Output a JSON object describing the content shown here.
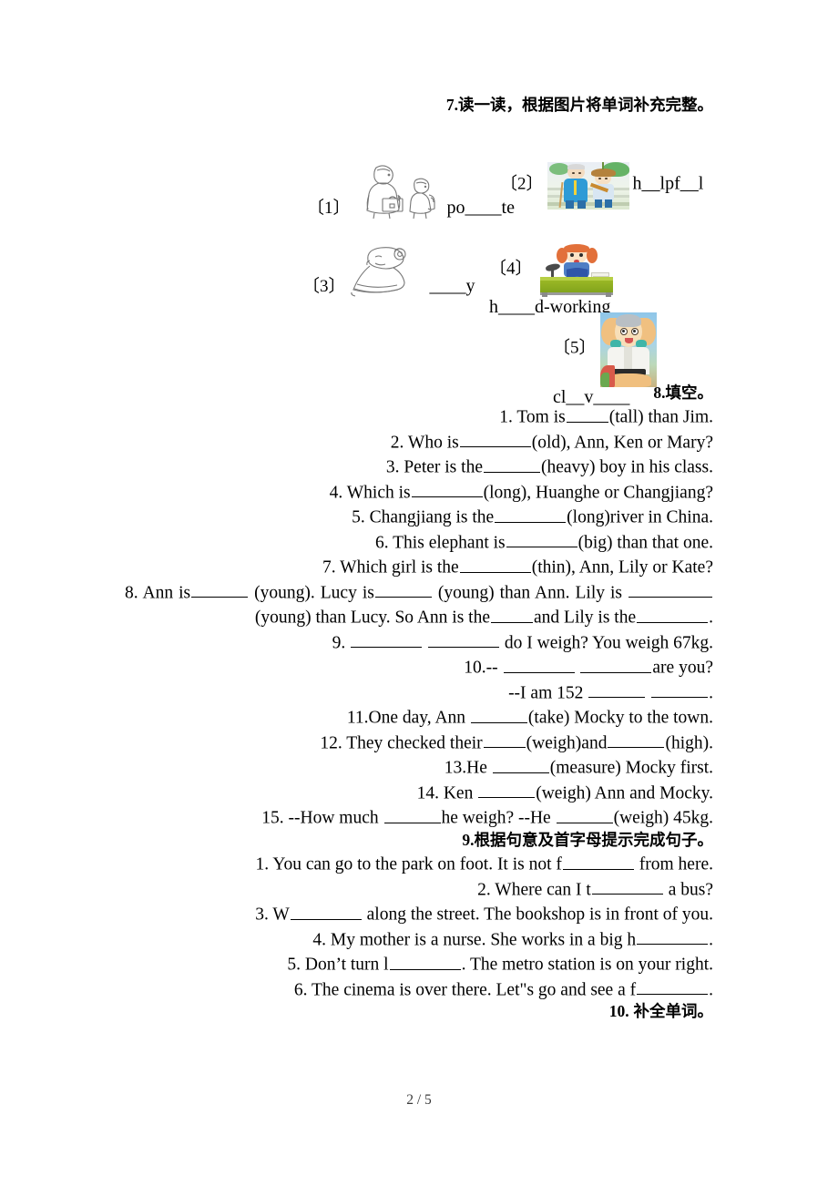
{
  "document": {
    "footer_page": "2 / 5"
  },
  "sections": [
    {
      "id": "section-7",
      "number": "7.",
      "heading": "读一读，根据图片将单词补充完整。",
      "type": "picture-word",
      "items": [
        {
          "label": "〔1〕",
          "word": "po____te",
          "image": "line-drawing-adult-with-briefcase-and-child-with-backpack"
        },
        {
          "label": "〔2〕",
          "word": "h__lpf__l",
          "image": "photo-boy-helping-elderly-man-with-cane"
        },
        {
          "label": "〔3〕",
          "word": "____y",
          "image": "line-drawing-person-face-with-flower"
        },
        {
          "label": "〔4〕",
          "word": "h____d-working",
          "image": "photo-girl-studying-at-green-desk-with-lamp"
        },
        {
          "label": "〔5〕",
          "word": "cl__v____",
          "image": "photo-cartoon-character-hands-behind-head"
        }
      ]
    },
    {
      "id": "section-8",
      "number": "8.",
      "heading": "填空。",
      "questions": [
        {
          "n": "1.",
          "parts": [
            "Tom is",
            "blank-sm",
            "(tall) than Jim."
          ]
        },
        {
          "n": "2.",
          "parts": [
            "Who is",
            "blank-lg",
            "(old), Ann, Ken or Mary?"
          ]
        },
        {
          "n": "3.",
          "parts": [
            "Peter is the",
            "blank-md",
            "(heavy) boy in his class."
          ]
        },
        {
          "n": "4.",
          "parts": [
            "Which is",
            "blank-lg",
            "(long), Huanghe or Changjiang?"
          ]
        },
        {
          "n": "5.",
          "parts": [
            "Changjiang is the",
            "blank-lg",
            "(long)river in China."
          ]
        },
        {
          "n": "6.",
          "parts": [
            "This elephant is",
            "blank-lg",
            "(big) than that one."
          ]
        },
        {
          "n": "7.",
          "parts": [
            "Which girl is the",
            "blank-lg",
            "(thin), Ann, Lily or Kate?"
          ]
        },
        {
          "n": "8.",
          "text_1": "Ann is",
          "text_2": "(young). Lucy is",
          "text_3": "(young) than Ann. Lily is",
          "text_4": "(young) than Lucy. So Ann is the",
          "text_5": "and Lily is the",
          "text_6": "."
        },
        {
          "n": "9.",
          "parts": [
            "",
            "blank-lg",
            "blank-lg",
            "do I weigh? You weigh 67kg."
          ]
        },
        {
          "n": "10.--",
          "parts": [
            "",
            "blank-lg",
            "blank-lg",
            "are you?"
          ]
        },
        {
          "n": "",
          "parts": [
            "--I am 152",
            "blank-md",
            "blank-md",
            "."
          ]
        },
        {
          "n": "11.",
          "parts": [
            "One day, Ann",
            "blank-md",
            "(take) Mocky to the town."
          ]
        },
        {
          "n": "12.",
          "parts": [
            "They checked their",
            "blank-sm",
            "(weigh)and",
            "blank-md",
            "(high)."
          ]
        },
        {
          "n": "13.",
          "parts": [
            "He",
            "blank-md",
            "(measure) Mocky first."
          ]
        },
        {
          "n": "14.",
          "parts": [
            "Ken",
            "blank-md",
            "(weigh) Ann and Mocky."
          ]
        },
        {
          "n": "15.",
          "parts": [
            "--How much",
            "blank-md",
            "he weigh?   --He",
            "blank-md",
            "(weigh) 45kg."
          ]
        }
      ]
    },
    {
      "id": "section-9",
      "number": "9.",
      "heading": "根据句意及首字母提示完成句子。",
      "questions": [
        {
          "n": "1.",
          "pre": "You can go to the park on foot. It is not f",
          "post": "from here."
        },
        {
          "n": "2.",
          "pre": "Where can I t",
          "post": "a bus?"
        },
        {
          "n": "3.",
          "pre": "W",
          "post": "along the street. The bookshop is in front of you."
        },
        {
          "n": "4.",
          "pre": "My mother is a nurse. She works in a big h",
          "post": "."
        },
        {
          "n": "5.",
          "pre": "Don’t turn l",
          "post": ". The metro station is on your right."
        },
        {
          "n": "6.",
          "pre": "The cinema is over there. Let\"s go and see a f",
          "post": "."
        }
      ]
    },
    {
      "id": "section-10",
      "number": "10.",
      "heading": "补全单词。"
    }
  ],
  "text": {
    "s8q1_a": "1. Tom is",
    "s8q1_b": "(tall) than Jim.",
    "s8q2_a": "2. Who is",
    "s8q2_b": "(old), Ann, Ken or Mary?",
    "s8q3_a": "3. Peter is the",
    "s8q3_b": "(heavy) boy in his class.",
    "s8q4_a": "4. Which is",
    "s8q4_b": "(long), Huanghe or Changjiang?",
    "s8q5_a": "5. Changjiang is the",
    "s8q5_b": "(long)river in China.",
    "s8q6_a": "6. This elephant is",
    "s8q6_b": "(big) than that one.",
    "s8q7_a": "7. Which girl is the",
    "s8q7_b": "(thin), Ann, Lily or Kate?",
    "s8q8_a": "8. Ann is",
    "s8q8_b": "(young). Lucy is",
    "s8q8_c": "(young) than Ann. Lily is",
    "s8q8_d": "(young) than Lucy. So Ann is the",
    "s8q8_e": "and Lily is the",
    "s8q8_f": ".",
    "s8q9_a": "9.",
    "s8q9_b": "do I weigh? You weigh 67kg.",
    "s8q10_a": "10.--",
    "s8q10_b": "are you?",
    "s8q10c_a": "--I am 152",
    "s8q10c_b": ".",
    "s8q11_a": "11.One day, Ann",
    "s8q11_b": "(take) Mocky to the town.",
    "s8q12_a": "12. They checked their",
    "s8q12_b": "(weigh)and",
    "s8q12_c": "(high).",
    "s8q13_a": "13.He",
    "s8q13_b": "(measure) Mocky first.",
    "s8q14_a": "14. Ken",
    "s8q14_b": "(weigh) Ann and Mocky.",
    "s8q15_a": "15. --How much",
    "s8q15_b": "he weigh?   --He",
    "s8q15_c": "(weigh) 45kg.",
    "s9q1_a": "1. You can go to the park on foot. It is not f",
    "s9q1_b": "from here.",
    "s9q2_a": "2. Where can I t",
    "s9q2_b": "a bus?",
    "s9q3_a": "3. W",
    "s9q3_b": "along the street. The bookshop is in front of you.",
    "s9q4_a": "4. My mother is a nurse. She works in a big h",
    "s9q4_b": ".",
    "s9q5_a": "5. Don’t turn l",
    "s9q5_b": ". The metro station is on your right.",
    "s9q6_a": "6. The cinema is over there. Let\"s go and see a f",
    "s9q6_b": ".",
    "s7_num": "7.",
    "s7_head": "读一读，根据图片将单词补充完整。",
    "s8_num": "8.",
    "s8_head": "填空。",
    "s9_num": "9.",
    "s9_head": "根据句意及首字母提示完成句子。",
    "s10_num": "10.",
    "s10_head": "补全单词。",
    "l1": "〔1〕",
    "l2": "〔2〕",
    "l3": "〔3〕",
    "l4": "〔4〕",
    "l5": "〔5〕",
    "w1": "po____te",
    "w2": "h__lpf__l",
    "w3": "____y",
    "w4": "h____d-working",
    "w5": "cl__v____"
  },
  "colors": {
    "ink": "#000000",
    "sketch": "#777777",
    "photo2_shirt": "#2e9bd6",
    "photo2_grass": "#cfe6b8",
    "photo4_desk": "#8fb020",
    "photo5_sky": "#8fc6e8"
  }
}
